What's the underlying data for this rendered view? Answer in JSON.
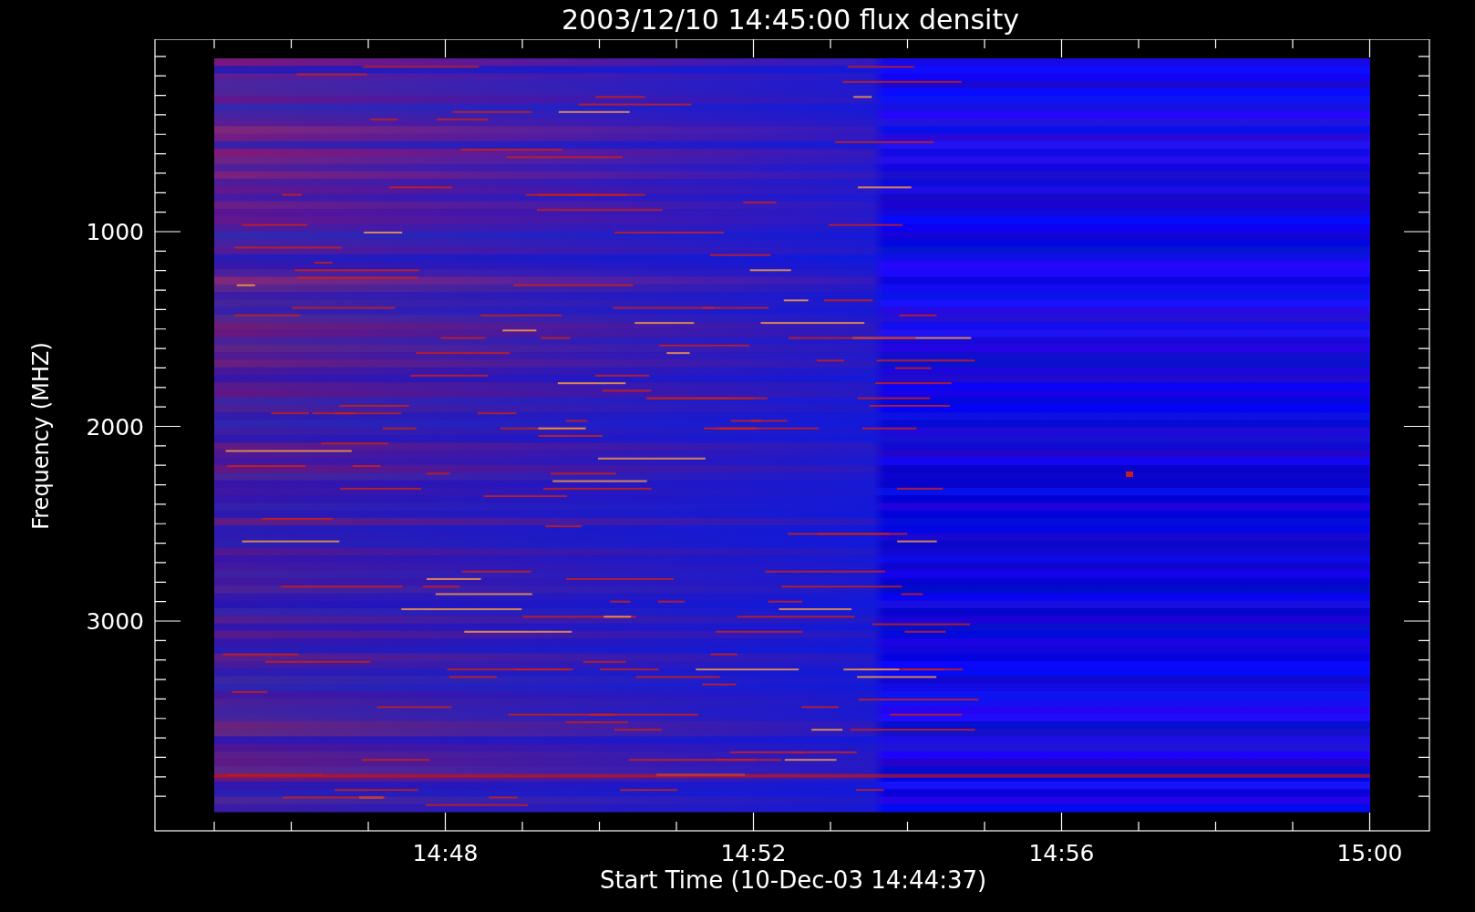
{
  "title": "2003/12/10 14:45:00 flux density",
  "x_axis": {
    "label": "Start Time (10-Dec-03 14:44:37)",
    "ticks": [
      "14:48",
      "14:52",
      "14:56",
      "15:00"
    ]
  },
  "y_axis": {
    "label": "Frequency (MHZ)",
    "ticks": [
      "1000",
      "2000",
      "3000"
    ]
  }
}
